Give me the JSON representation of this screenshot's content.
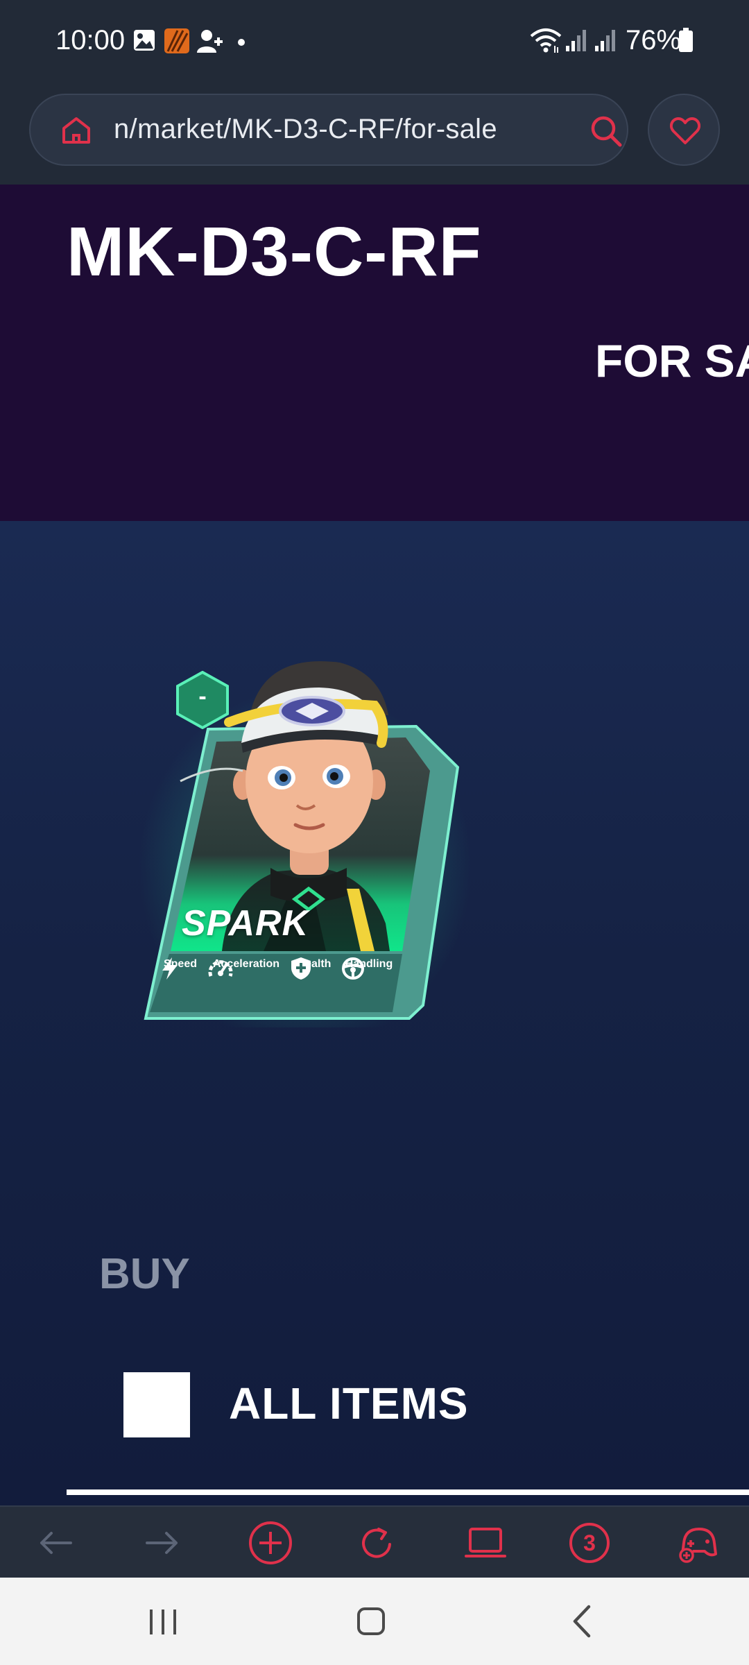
{
  "status_bar": {
    "time": "10:00",
    "battery": "76%",
    "icons": [
      "gallery-icon",
      "app-icon",
      "person-add-icon",
      "dot-icon",
      "wifi-icon",
      "signal-icon",
      "signal-icon",
      "battery-icon"
    ]
  },
  "address_bar": {
    "url": "n/market/MK-D3-C-RF/for-sale",
    "accent_color": "#e0314b"
  },
  "hero": {
    "title": "MK-D3-C-RF",
    "subtitle": "FOR SA"
  },
  "card": {
    "name": "SPARK",
    "tier": "-",
    "stats": [
      {
        "label": "Speed",
        "icon": "lightning-icon"
      },
      {
        "label": "Acceleration",
        "icon": "speedometer-icon"
      },
      {
        "label": "Health",
        "icon": "shield-icon"
      },
      {
        "label": "Handling",
        "icon": "steering-wheel-icon"
      }
    ]
  },
  "buy": {
    "heading": "BUY",
    "filter_label": "ALL ITEMS"
  },
  "browser_toolbar": {
    "tab_count": "3"
  }
}
